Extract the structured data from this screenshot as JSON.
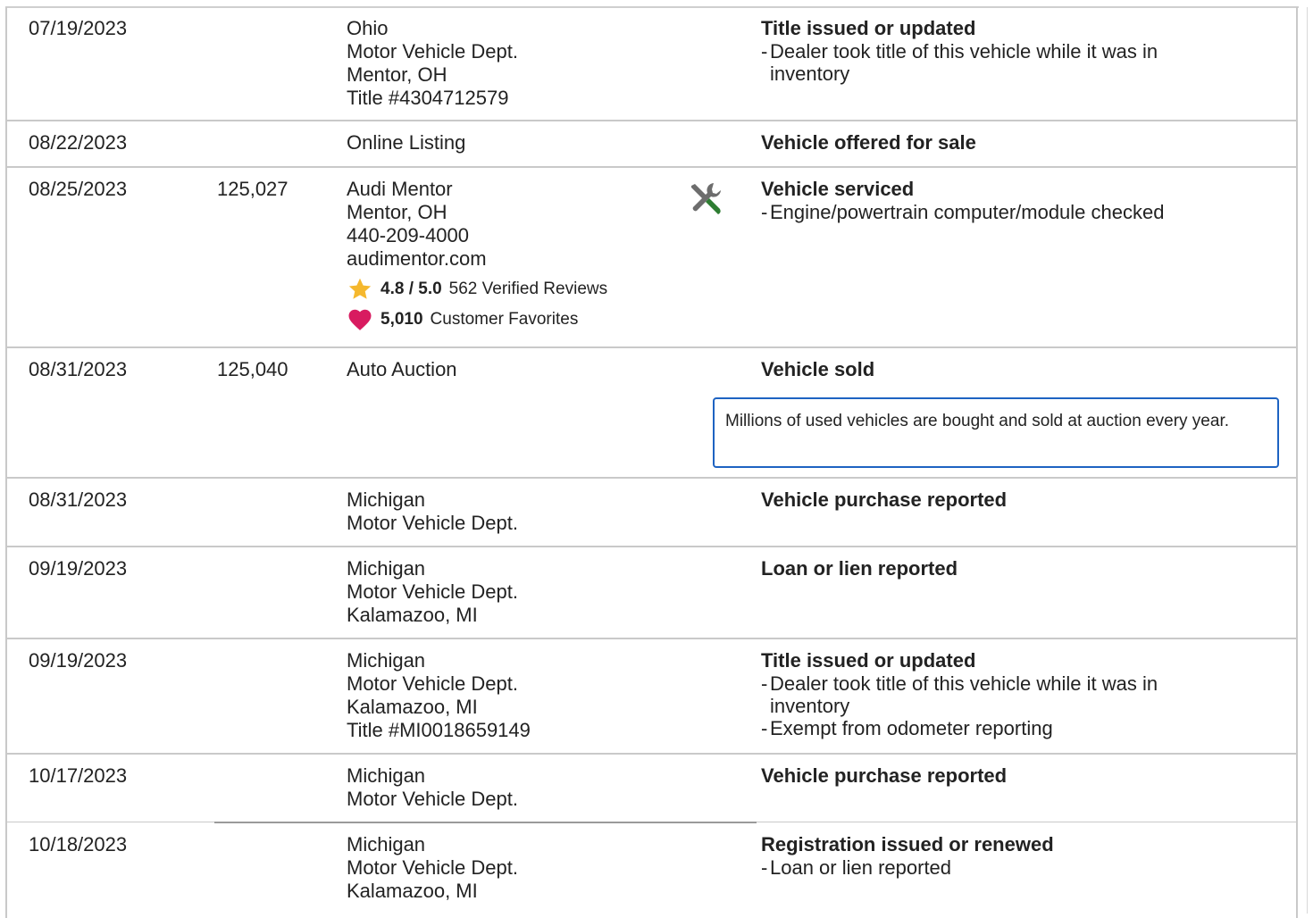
{
  "rows": [
    {
      "date": "07/19/2023",
      "odometer": "",
      "source": [
        "Ohio",
        "Motor Vehicle Dept.",
        "Mentor, OH",
        "Title #4304712579"
      ],
      "event_title": "Title issued or updated",
      "event_details": [
        "Dealer took title of this vehicle while it was in inventory"
      ]
    },
    {
      "date": "08/22/2023",
      "odometer": "",
      "source": [
        "Online Listing"
      ],
      "event_title": "Vehicle offered for sale",
      "event_details": []
    },
    {
      "date": "08/25/2023",
      "odometer": "125,027",
      "source": [
        "Audi Mentor",
        "Mentor, OH",
        "440-209-4000",
        "audimentor.com"
      ],
      "rating": {
        "score": "4.8 / 5.0",
        "reviews": "562 Verified Reviews"
      },
      "favorites": {
        "count": "5,010",
        "label": "Customer Favorites"
      },
      "icon": "service-tools-icon",
      "event_title": "Vehicle serviced",
      "event_details": [
        "Engine/powertrain computer/module checked"
      ]
    },
    {
      "date": "08/31/2023",
      "odometer": "125,040",
      "source": [
        "Auto Auction"
      ],
      "event_title": "Vehicle sold",
      "event_details": [],
      "note": "Millions of used vehicles are bought and sold at auction every year."
    },
    {
      "date": "08/31/2023",
      "odometer": "",
      "source": [
        "Michigan",
        "Motor Vehicle Dept."
      ],
      "event_title": "Vehicle purchase reported",
      "event_details": []
    },
    {
      "date": "09/19/2023",
      "odometer": "",
      "source": [
        "Michigan",
        "Motor Vehicle Dept.",
        "Kalamazoo, MI"
      ],
      "event_title": "Loan or lien reported",
      "event_details": []
    },
    {
      "date": "09/19/2023",
      "odometer": "",
      "source": [
        "Michigan",
        "Motor Vehicle Dept.",
        "Kalamazoo, MI",
        "Title #MI0018659149"
      ],
      "event_title": "Title issued or updated",
      "event_details": [
        "Dealer took title of this vehicle while it was in inventory",
        "Exempt from odometer reporting"
      ]
    },
    {
      "date": "10/17/2023",
      "odometer": "",
      "source": [
        "Michigan",
        "Motor Vehicle Dept."
      ],
      "event_title": "Vehicle purchase reported",
      "event_details": []
    },
    {
      "date": "10/18/2023",
      "odometer": "",
      "source": [
        "Michigan",
        "Motor Vehicle Dept.",
        "Kalamazoo, MI"
      ],
      "event_title": "Registration issued or renewed",
      "event_details": [
        "Loan or lien reported"
      ]
    }
  ],
  "colors": {
    "star": "#f5b82e",
    "heart": "#d81b60",
    "note_border": "#1e63c2",
    "icon_gray": "#6d6d6d",
    "icon_green": "#2e7d32"
  }
}
